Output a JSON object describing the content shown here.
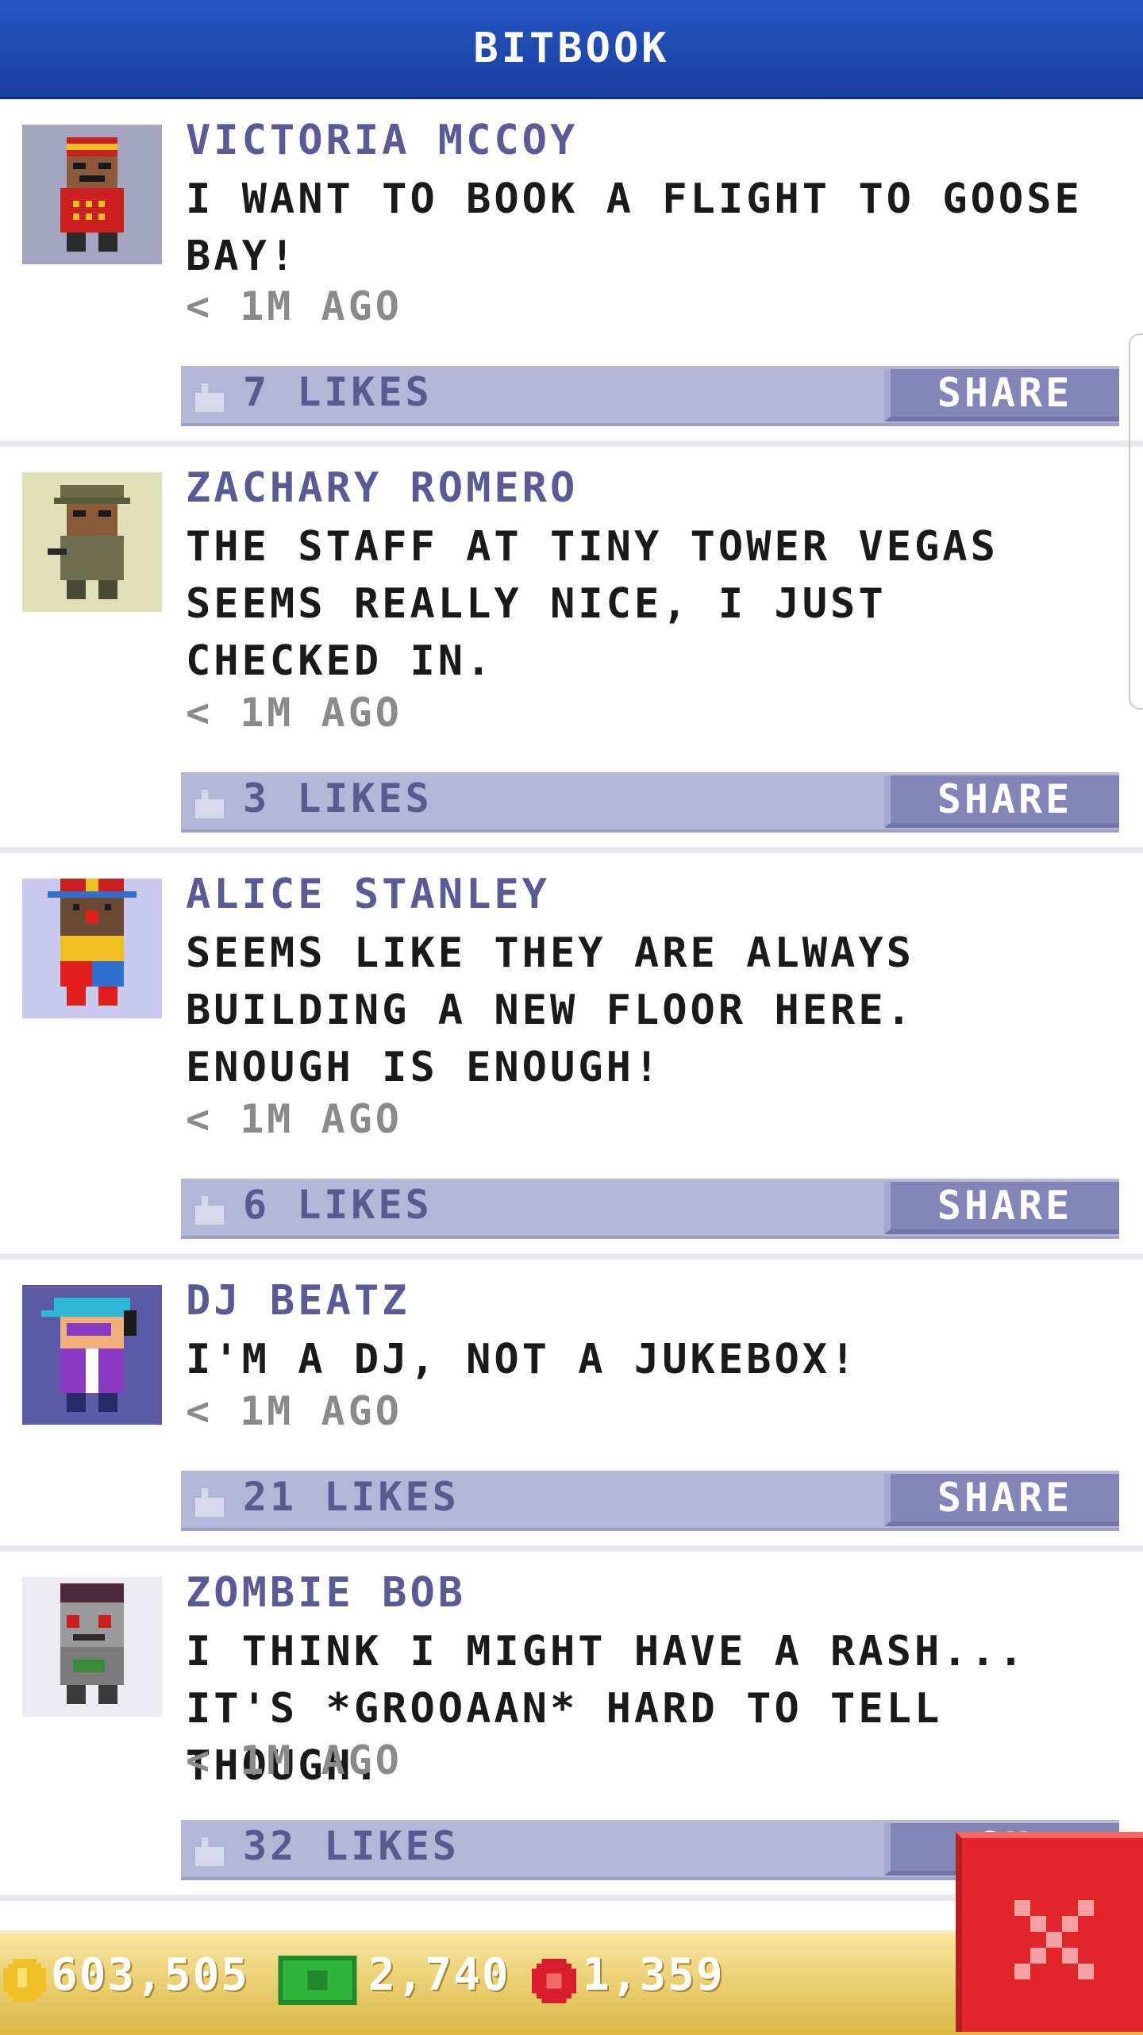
{
  "header": {
    "title": "BITBOOK"
  },
  "posts": [
    {
      "name": "VICTORIA MCCOY",
      "message": "I WANT TO BOOK A FLIGHT TO GOOSE BAY!",
      "time": "< 1M AGO",
      "likes": "7 LIKES",
      "share": "SHARE",
      "avatar_icon": "bellhop-avatar-icon",
      "avatar_bg": "#a4a6c0"
    },
    {
      "name": "ZACHARY ROMERO",
      "message": "THE STAFF AT TINY TOWER VEGAS SEEMS REALLY NICE, I JUST CHECKED IN.",
      "time": "< 1M AGO",
      "likes": "3 LIKES",
      "share": "SHARE",
      "avatar_icon": "soldier-avatar-icon",
      "avatar_bg": "#e0e0b8"
    },
    {
      "name": "ALICE STANLEY",
      "message": "SEEMS LIKE THEY ARE ALWAYS BUILDING A NEW FLOOR HERE. ENOUGH IS ENOUGH!",
      "time": "< 1M AGO",
      "likes": "6 LIKES",
      "share": "SHARE",
      "avatar_icon": "clown-avatar-icon",
      "avatar_bg": "#c9c9f0"
    },
    {
      "name": "DJ BEATZ",
      "message": "I'M A DJ, NOT A JUKEBOX!",
      "time": "< 1M AGO",
      "likes": "21 LIKES",
      "share": "SHARE",
      "avatar_icon": "dj-avatar-icon",
      "avatar_bg": "#5c5aa6"
    },
    {
      "name": "ZOMBIE BOB",
      "message": "I THINK I MIGHT HAVE A RASH... IT'S *GROOAAN* HARD TO TELL THOUGH.",
      "time": "< 1M AGO",
      "likes": "32 LIKES",
      "share": "SH",
      "avatar_icon": "zombie-avatar-icon",
      "avatar_bg": "#ebebf1"
    }
  ],
  "status": {
    "coins": "603,505",
    "bux": "2,740",
    "stars": "1,359"
  },
  "colors": {
    "header": "#1f4fb6",
    "name": "#5a5a96",
    "likes_bar": "#b4b6d8",
    "share": "#8385b8",
    "bottom_bar": "#e6c560",
    "close": "#e0262b"
  },
  "close_button": {
    "icon": "close-icon"
  }
}
